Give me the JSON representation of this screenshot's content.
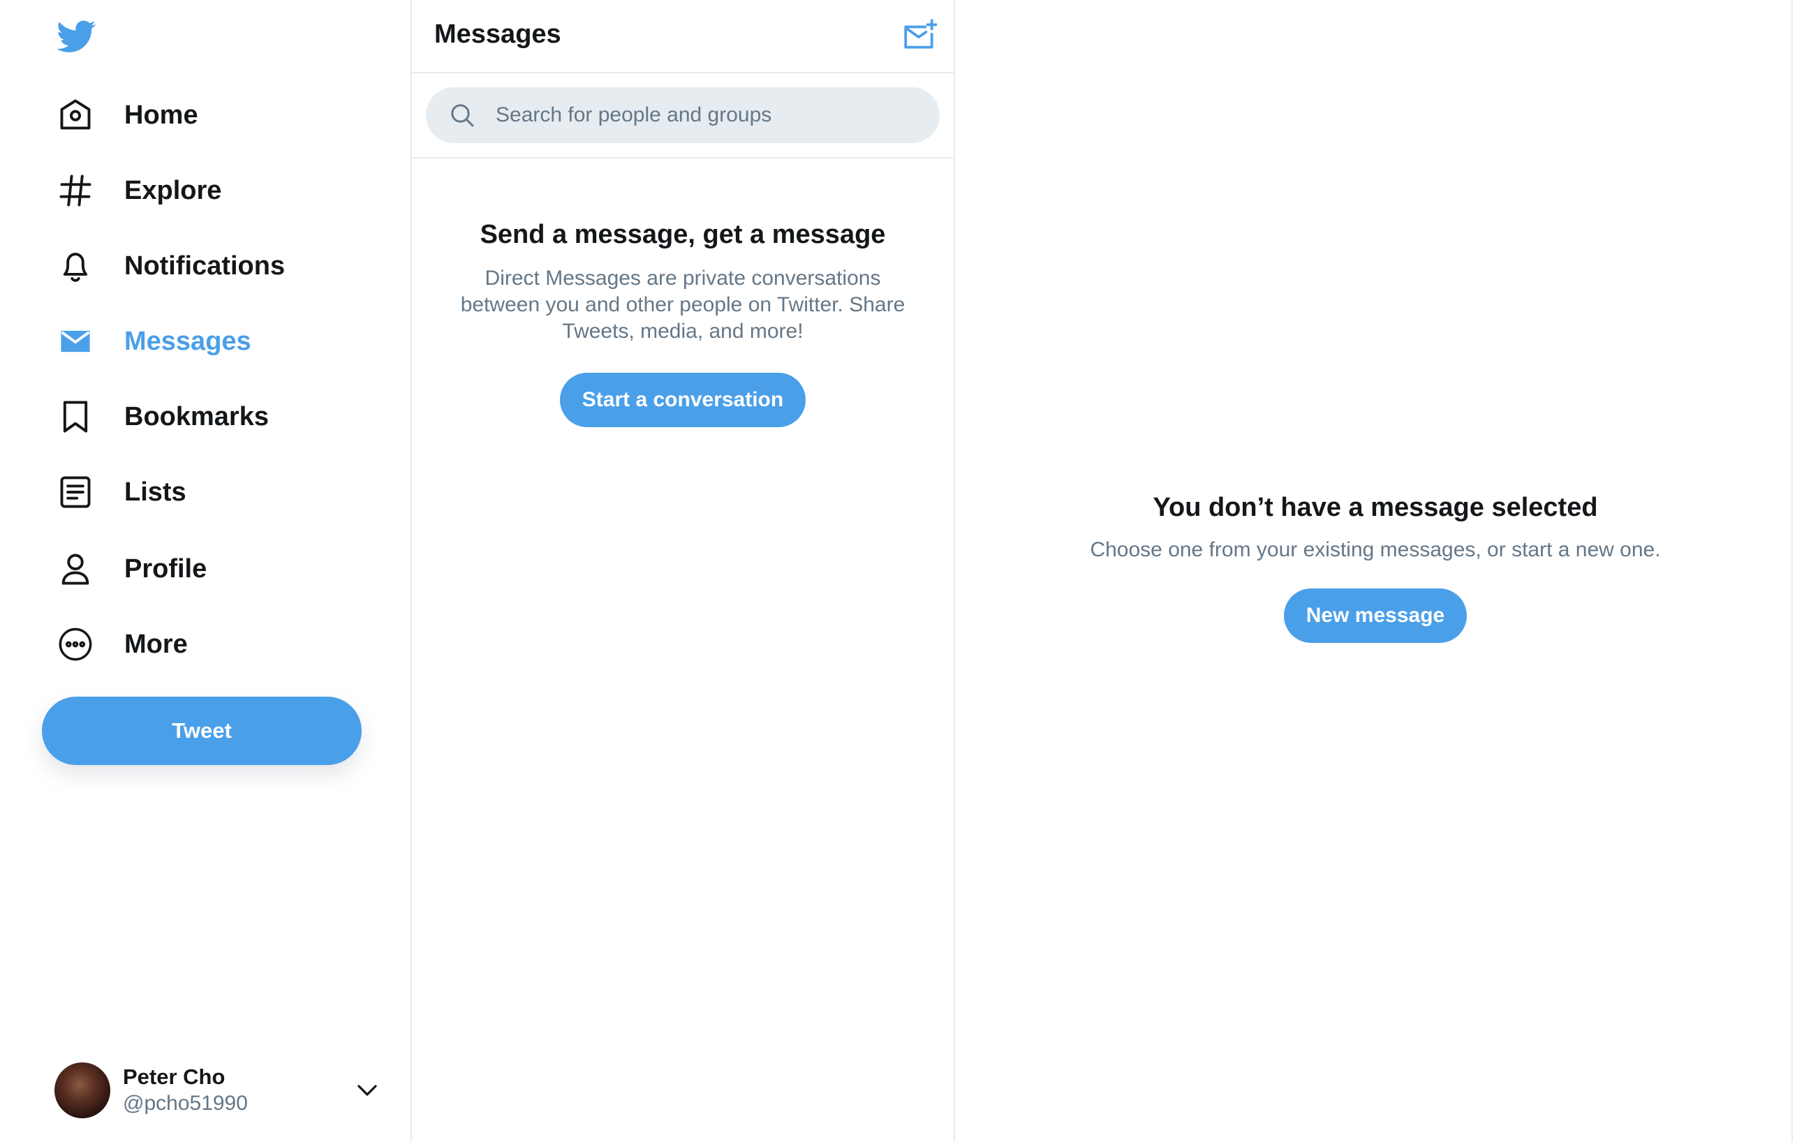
{
  "sidebar": {
    "logo": "twitter-bird-icon",
    "nav": [
      {
        "label": "Home",
        "icon": "home-icon"
      },
      {
        "label": "Explore",
        "icon": "hashtag-icon"
      },
      {
        "label": "Notifications",
        "icon": "bell-icon"
      },
      {
        "label": "Messages",
        "icon": "envelope-icon",
        "active": true
      },
      {
        "label": "Bookmarks",
        "icon": "bookmark-icon"
      },
      {
        "label": "Lists",
        "icon": "list-icon"
      },
      {
        "label": "Profile",
        "icon": "person-icon"
      },
      {
        "label": "More",
        "icon": "more-circle-icon"
      }
    ],
    "tweet_button": "Tweet",
    "account": {
      "name": "Peter Cho",
      "handle": "@pcho51990"
    }
  },
  "messages": {
    "title": "Messages",
    "compose_icon": "compose-message-icon",
    "search": {
      "placeholder": "Search for people and groups",
      "value": ""
    },
    "empty_state": {
      "title": "Send a message, get a message",
      "body": "Direct Messages are private conversations between you and other people on Twitter. Share Tweets, media, and more!",
      "button": "Start a conversation"
    }
  },
  "detail": {
    "title": "You don’t have a message selected",
    "subtitle": "Choose one from your existing messages, or start a new one.",
    "button": "New message"
  },
  "colors": {
    "accent": "#4a9fe9",
    "text": "#14171a",
    "secondary_text": "#657786",
    "border": "#e6ecf0"
  }
}
